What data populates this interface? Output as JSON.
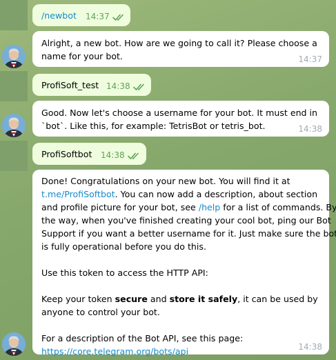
{
  "messages": [
    {
      "type": "out",
      "text": "/newbot",
      "time": "14:37"
    },
    {
      "type": "in",
      "lines": [
        "Alright, a new bot. How are we going to call it? Please choose a",
        "name for your bot."
      ],
      "time": "14:37"
    },
    {
      "type": "out",
      "text": "ProfiSoft_test",
      "time": "14:38"
    },
    {
      "type": "in",
      "lines": [
        "Good. Now let's choose a username for your bot. It must end in",
        "`bot`. Like this, for example: TetrisBot or tetris_bot."
      ],
      "time": "14:38"
    },
    {
      "type": "out",
      "text": "ProfiSoftbot",
      "time": "14:38"
    },
    {
      "type": "in",
      "time": "14:38",
      "p1_a": "Done! Congratulations on your new bot. You will find it at",
      "p1_link": "t.me/ProfiSoftbot",
      "p1_b": ". You can now add a description, about section",
      "p1_c": "and profile picture for your bot, see ",
      "p1_help": "/help",
      "p1_d": " for a list of commands. By",
      "p1_e": "the way, when you've finished creating your cool bot, ping our Bot",
      "p1_f": "Support if you want a better username for it. Just make sure the bot",
      "p1_g": "is fully operational before you do this.",
      "p2": "Use this token to access the HTTP API:",
      "p3_a": "Keep your token ",
      "p3_b": "secure",
      "p3_c": " and ",
      "p3_d": "store it safely",
      "p3_e": ", it can be used by",
      "p3_f": "anyone to control your bot.",
      "p4": "For a description of the Bot API, see this page:",
      "p4_link": "https://core.telegram.org/bots/api"
    }
  ],
  "colors": {
    "outgoing": "#effdde",
    "incoming": "#ffffff",
    "link": "#168acd",
    "check": "#5ea357"
  },
  "icons": {
    "read": "double-check-icon",
    "avatar": "bot-avatar-icon"
  }
}
